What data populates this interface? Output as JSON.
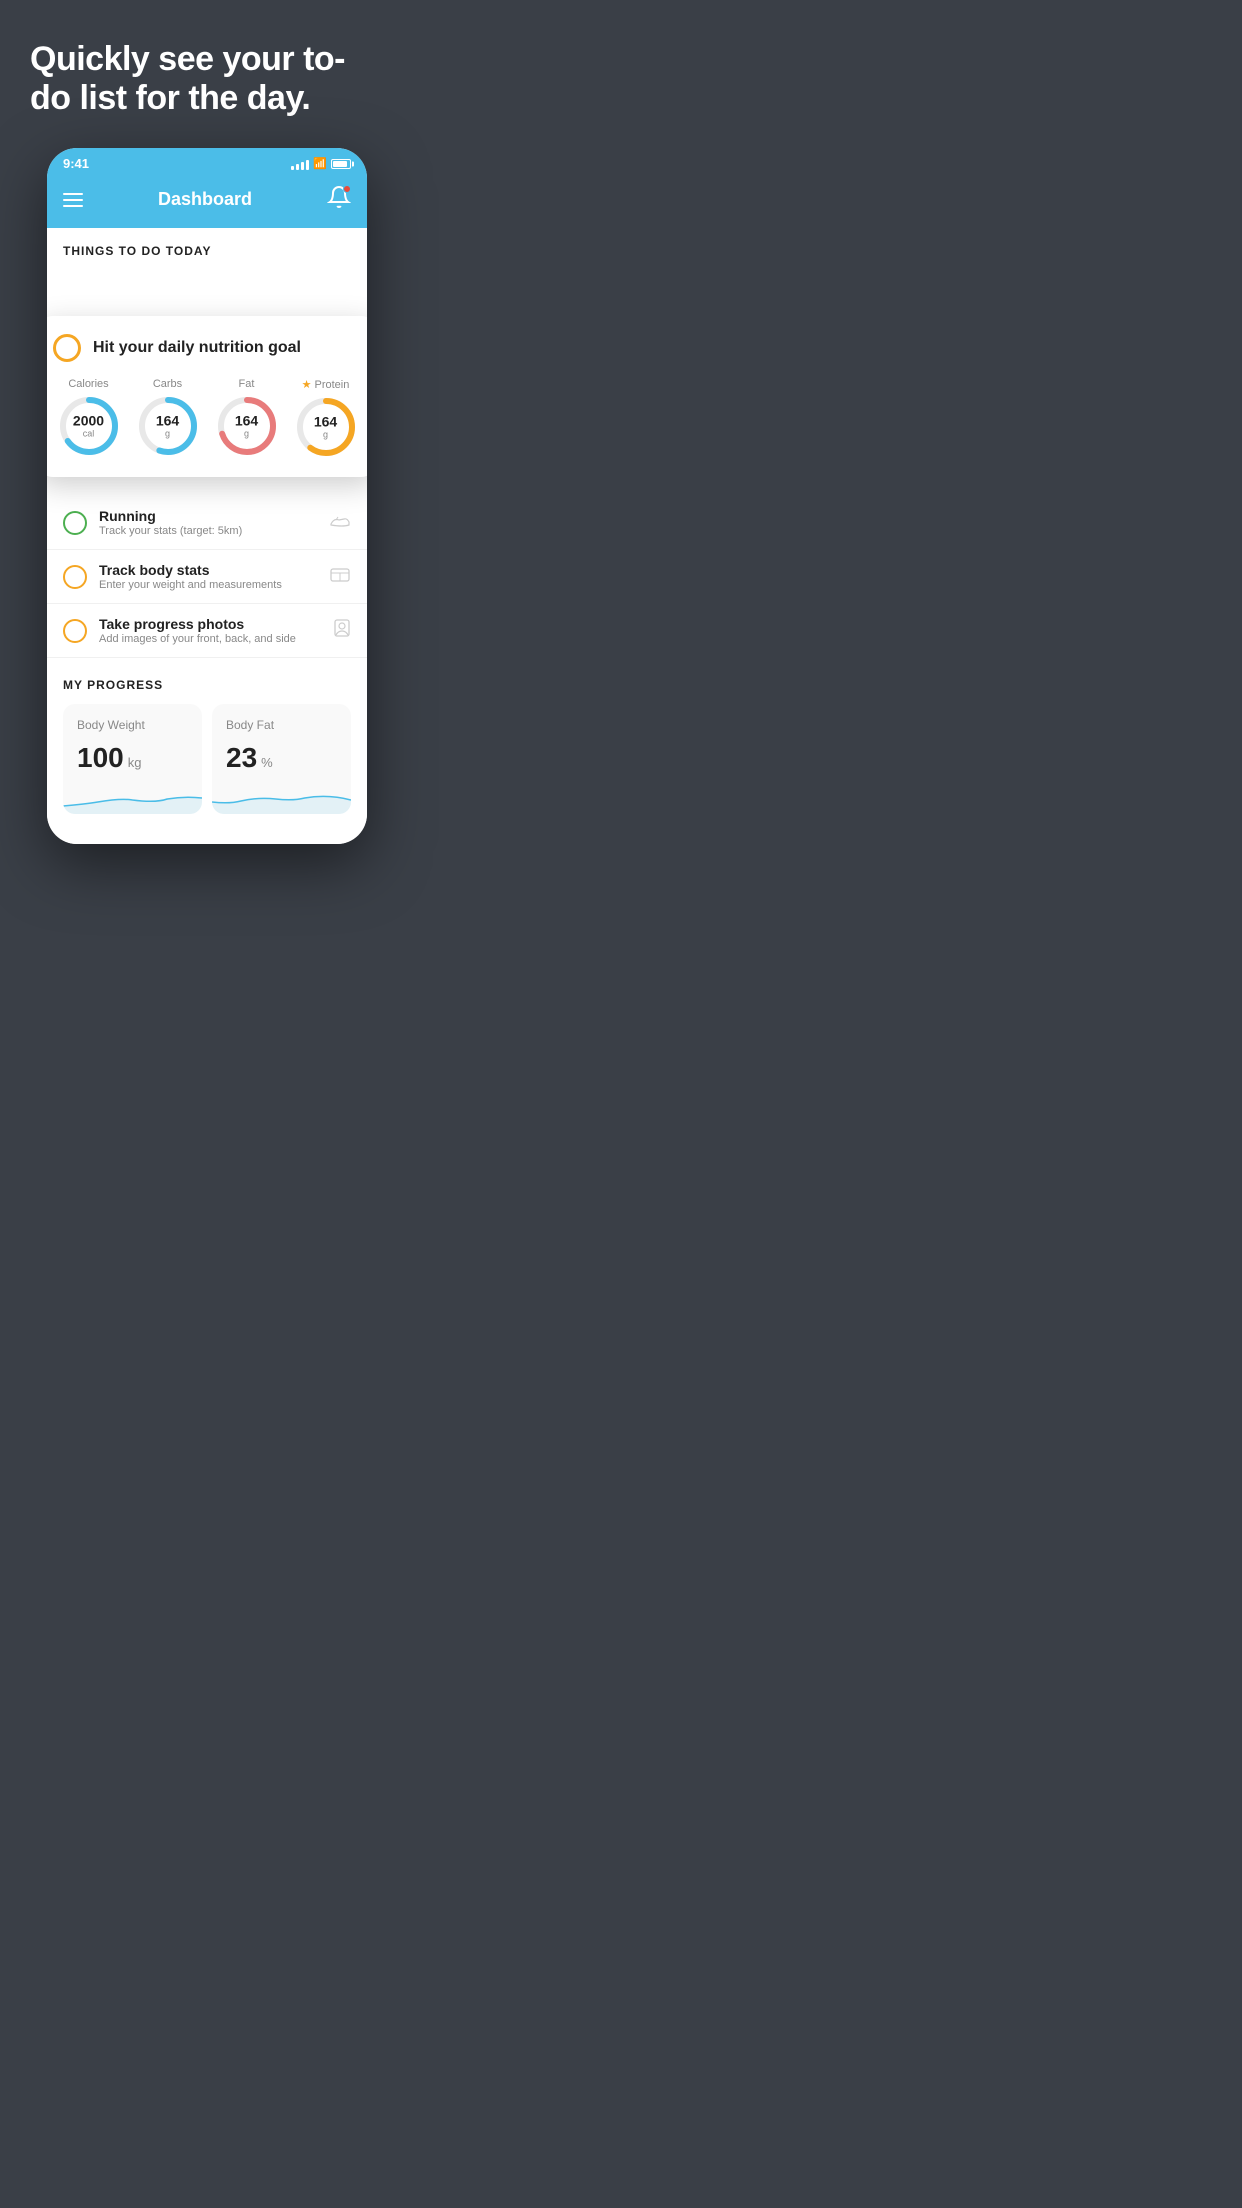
{
  "hero": {
    "title": "Quickly see your to-do list for the day."
  },
  "status_bar": {
    "time": "9:41"
  },
  "header": {
    "title": "Dashboard"
  },
  "things_section": {
    "label": "THINGS TO DO TODAY"
  },
  "nutrition_card": {
    "check_label": "Hit your daily nutrition goal",
    "items": [
      {
        "label": "Calories",
        "value": "2000",
        "unit": "cal",
        "color": "#4bbde8",
        "pct": 65,
        "starred": false
      },
      {
        "label": "Carbs",
        "value": "164",
        "unit": "g",
        "color": "#4bbde8",
        "pct": 55,
        "starred": false
      },
      {
        "label": "Fat",
        "value": "164",
        "unit": "g",
        "color": "#e87b7b",
        "pct": 70,
        "starred": false
      },
      {
        "label": "Protein",
        "value": "164",
        "unit": "g",
        "color": "#f5a623",
        "pct": 60,
        "starred": true
      }
    ]
  },
  "todo_items": [
    {
      "title": "Running",
      "sub": "Track your stats (target: 5km)",
      "circle_color": "green",
      "icon": "shoe"
    },
    {
      "title": "Track body stats",
      "sub": "Enter your weight and measurements",
      "circle_color": "yellow",
      "icon": "scale"
    },
    {
      "title": "Take progress photos",
      "sub": "Add images of your front, back, and side",
      "circle_color": "yellow",
      "icon": "person"
    }
  ],
  "progress": {
    "label": "MY PROGRESS",
    "cards": [
      {
        "title": "Body Weight",
        "value": "100",
        "unit": "kg"
      },
      {
        "title": "Body Fat",
        "value": "23",
        "unit": "%"
      }
    ]
  }
}
